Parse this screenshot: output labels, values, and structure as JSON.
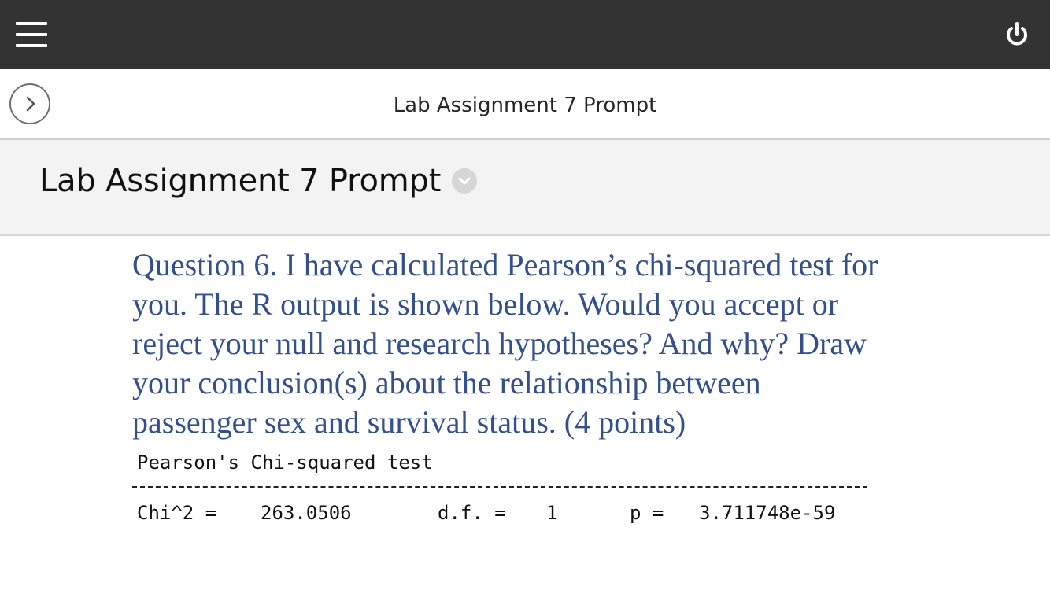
{
  "topbar": {
    "menu_icon": "hamburger-menu-icon",
    "power_icon": "power-icon"
  },
  "navbar": {
    "toggle_icon": "chevron-right-icon",
    "title": "Lab Assignment 7 Prompt"
  },
  "header": {
    "title": "Lab Assignment 7 Prompt",
    "options_icon": "chevron-down-icon"
  },
  "content": {
    "question": "Question 6. I have calculated Pearson’s chi-squared test for you. The R output is shown below. Would you accept or reject your null and research hypotheses? And why? Draw your conclusion(s) about the relationship between passenger sex and survival status. (4 points)",
    "r_output": {
      "title": "Pearson's Chi-squared test",
      "chi_label": "Chi^2 =",
      "chi_value": "263.0506",
      "df_label": "d.f. =",
      "df_value": "1",
      "p_label": "p =",
      "p_value": "3.711748e-59"
    }
  },
  "colors": {
    "topbar": "#333333",
    "question_text": "#33508d",
    "header_bg": "#f3f3f3"
  }
}
